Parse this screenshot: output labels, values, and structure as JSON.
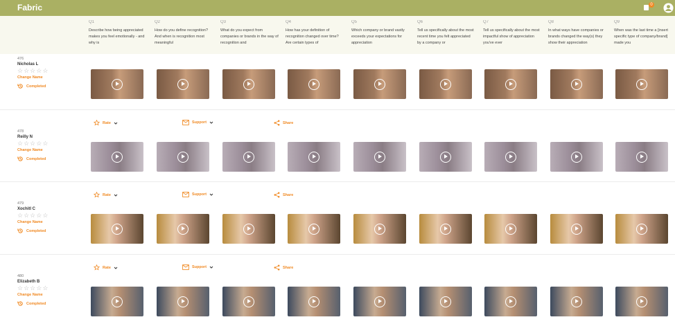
{
  "app": {
    "brand": "Fabric",
    "notification_count": "0"
  },
  "questions": [
    {
      "num": "Q1",
      "text": "Describe how being appreciated makes you feel emotionally - and why is"
    },
    {
      "num": "Q2",
      "text": "How do you define recognition? And when is recognition most meaningful"
    },
    {
      "num": "Q3",
      "text": "What do you expect from companies or brands in the way of recognition and"
    },
    {
      "num": "Q4",
      "text": "How has your definition of recognition changed over time? Are certain types of"
    },
    {
      "num": "Q5",
      "text": "Which company or brand vastly exceeds your expectations for appreciation"
    },
    {
      "num": "Q6",
      "text": "Tell us specifically about the most recent time you felt appreciated by a company or"
    },
    {
      "num": "Q7",
      "text": "Tell us specifically about the most impactful show of appreciation you've ever"
    },
    {
      "num": "Q8",
      "text": "In what ways have companies or brands changed the way(s) they show their appreciation"
    },
    {
      "num": "Q9",
      "text": "When was the last time a [insert specific type of company/brand] made you"
    }
  ],
  "respondents": [
    {
      "id": "476",
      "name": "Nicholas L",
      "rating": 0,
      "change_name": "Change Name",
      "status": "Completed"
    },
    {
      "id": "478",
      "name": "Reilly N",
      "rating": 0,
      "change_name": "Change Name",
      "status": "Completed"
    },
    {
      "id": "479",
      "name": "Xochitl C",
      "rating": 0,
      "change_name": "Change Name",
      "status": "Completed"
    },
    {
      "id": "480",
      "name": "Elizabeth B",
      "rating": 0,
      "change_name": "Change Name",
      "status": "Completed"
    }
  ],
  "actions": {
    "rate": "Rate",
    "support": "Support",
    "share": "Share"
  },
  "icons": {
    "notification": "notification-icon",
    "user": "user-avatar-icon",
    "star": "star-icon",
    "completed": "history-icon",
    "play": "play-icon",
    "chevron": "chevron-down-icon",
    "mail": "mail-icon",
    "share": "share-icon"
  },
  "colors": {
    "topbar": "#aab063",
    "accent": "#f08a24",
    "header_bg": "#f8f8ee"
  }
}
